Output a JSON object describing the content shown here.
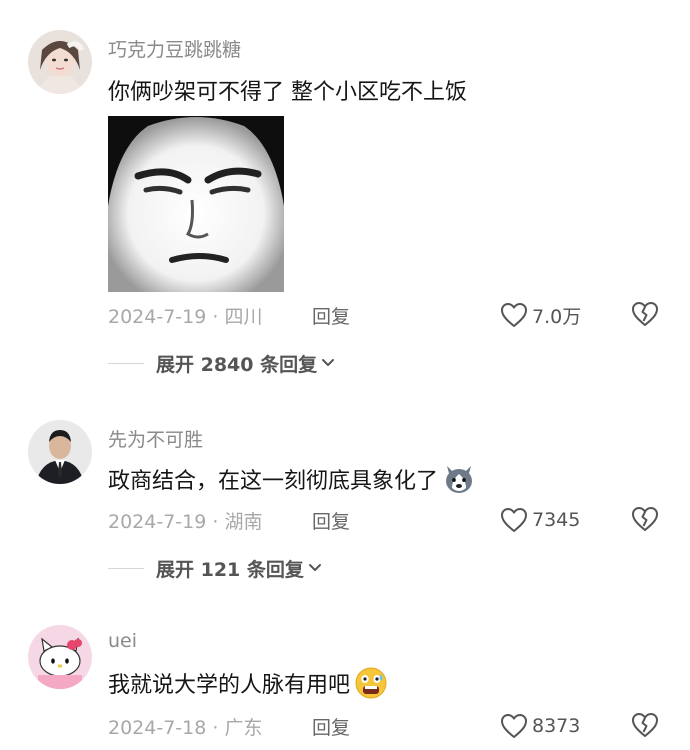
{
  "comments": [
    {
      "username": "巧克力豆跳跳糖",
      "text": "你俩吵架可不得了 整个小区吃不上饭",
      "date_location": "2024-7-19 · 四川",
      "reply_label": "回复",
      "likes": "7.0万",
      "expand_label": "展开 2840 条回复"
    },
    {
      "username": "先为不可胜",
      "text": "政商结合，在这一刻彻底具象化了",
      "date_location": "2024-7-19 · 湖南",
      "reply_label": "回复",
      "likes": "7345",
      "expand_label": "展开 121 条回复"
    },
    {
      "username": "uei",
      "text": "我就说大学的人脉有用吧",
      "date_location": "2024-7-18 · 广东",
      "reply_label": "回复",
      "likes": "8373"
    }
  ],
  "icons": {
    "like": "heart-outline-icon",
    "dislike": "broken-heart-icon",
    "expand": "chevron-down-icon"
  },
  "colors": {
    "username": "#8a8a8a",
    "meta": "#a8a8a8",
    "text": "#161616"
  }
}
